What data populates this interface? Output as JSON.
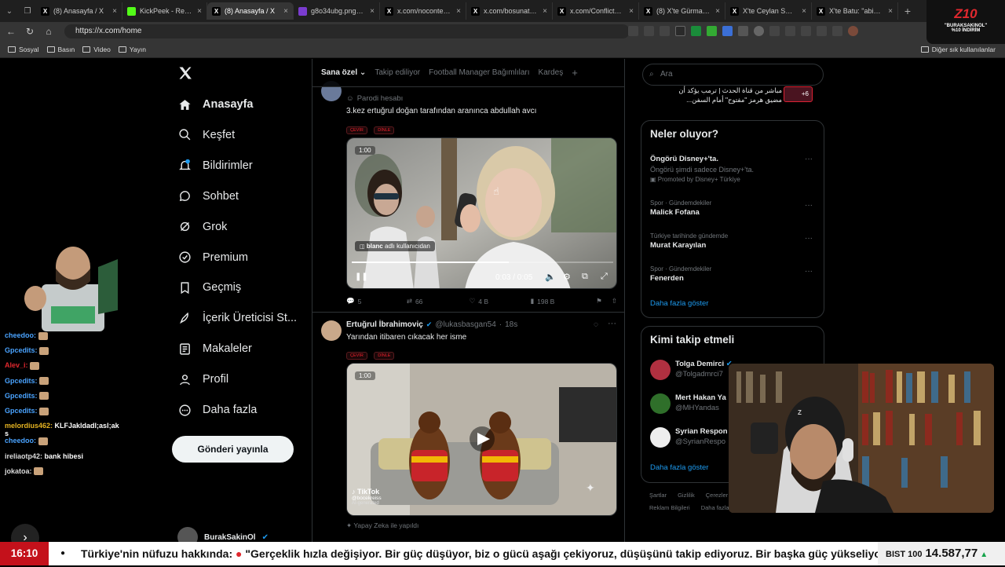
{
  "browser": {
    "tabs": [
      {
        "title": "(8) Anasayfa / X",
        "favicon": "x",
        "active": false
      },
      {
        "title": "KickPeek - Real-time",
        "favicon": "kick",
        "active": false
      },
      {
        "title": "(8) Anasayfa / X",
        "favicon": "x",
        "active": true
      },
      {
        "title": "g8o34ubg.png | Hız",
        "favicon": "img",
        "active": false
      },
      {
        "title": "x.com/noconteks12",
        "favicon": "x",
        "active": false
      },
      {
        "title": "x.com/bosunatiklam",
        "favicon": "x",
        "active": false
      },
      {
        "title": "x.com/ConflictTR/st",
        "favicon": "x",
        "active": false
      },
      {
        "title": "(8) X'te Gürman: \"H",
        "favicon": "x",
        "active": false
      },
      {
        "title": "X'te Ceylan Sever: \"I",
        "favicon": "x",
        "active": false
      },
      {
        "title": "X'te Batu: \"abisinin",
        "favicon": "x",
        "active": false
      }
    ],
    "url": "https://x.com/home",
    "bookmarks": [
      "Sosyal",
      "Basın",
      "Video",
      "Yayın"
    ],
    "other_bookmarks": "Diğer sık kullanılanlar"
  },
  "stream_logo": {
    "brand": "Z10",
    "line1": "\"BURAKSAKINOL\"",
    "line2": "%10 İNDİRİM"
  },
  "nav": {
    "items": [
      {
        "label": "Anasayfa",
        "icon": "home-icon",
        "active": true
      },
      {
        "label": "Keşfet",
        "icon": "search-icon",
        "active": false
      },
      {
        "label": "Bildirimler",
        "icon": "bell-icon",
        "active": false
      },
      {
        "label": "Sohbet",
        "icon": "chat-icon",
        "active": false
      },
      {
        "label": "Grok",
        "icon": "grok-icon",
        "active": false
      },
      {
        "label": "Premium",
        "icon": "premium-icon",
        "active": false
      },
      {
        "label": "Geçmiş",
        "icon": "bookmark-icon",
        "active": false
      },
      {
        "label": "İçerik Üreticisi St...",
        "icon": "rocket-icon",
        "active": false
      },
      {
        "label": "Makaleler",
        "icon": "article-icon",
        "active": false
      },
      {
        "label": "Profil",
        "icon": "person-icon",
        "active": false
      },
      {
        "label": "Daha fazla",
        "icon": "more-circle-icon",
        "active": false
      }
    ],
    "post_button": "Gönderi yayınla",
    "account_name": "BurakSakinOl"
  },
  "feed": {
    "tabs": [
      "Sana özel",
      "Takip ediliyor",
      "Football Manager Bağımlıları",
      "Kardeş"
    ],
    "tweets": [
      {
        "parody_label": "Parodi hesabı",
        "text": "3.kez ertuğrul doğan tarafından aranınca abdullah avcı",
        "badges": [
          "ÇEVİR",
          "DİNLE"
        ],
        "video_badge": "1:00",
        "video_credit_user": "blanc",
        "video_credit_text": "adlı kullanıcıdan",
        "video_time": "0:03 / 0:05",
        "video_progress": 0.6,
        "replies": "5",
        "reposts": "66",
        "likes": "4 B",
        "views": "198 B"
      },
      {
        "name": "Ertuğrul İbrahimoviç",
        "handle": "@lukasbasgan54",
        "time": "18s",
        "text": "Yarından itibaren cıkacak her isme",
        "badges": [
          "ÇEVİR",
          "DİNLE"
        ],
        "video_badge": "1:00",
        "tiktok_label": "TikTok",
        "tiktok_user": "@bocekreiss",
        "ai_label": "AI-generated",
        "ai_note": "Yapay Zeka ile yapıldı"
      }
    ]
  },
  "right": {
    "search_placeholder": "Ara",
    "top_snippet_line1": "مباشر من قناة الحدث | ترمب يؤكد أن",
    "top_snippet_line2": "مضيق هرمز \"مفتوح\" أمام السفن...",
    "top_snippet_badge": "+6",
    "trends_title": "Neler oluyor?",
    "trends": [
      {
        "category": "",
        "title": "Öngörü Disney+'ta.",
        "subtitle": "Öngörü şimdi sadece Disney+'ta.",
        "promoted": "Promoted by Disney+ Türkiye"
      },
      {
        "category": "Spor · Gündemdekiler",
        "title": "Malick Fofana"
      },
      {
        "category": "Türkiye tarihinde gündemde",
        "title": "Murat Karayılan"
      },
      {
        "category": "Spor · Gündemdekiler",
        "title": "Fenerden"
      }
    ],
    "trends_more": "Daha fazla göster",
    "who_title": "Kimi takip etmeli",
    "who": [
      {
        "name": "Tolga Demirci",
        "handle": "@Tolgadmrci7",
        "verified": true
      },
      {
        "name": "Mert Hakan Ya",
        "handle": "@MHYandas",
        "verified": false
      },
      {
        "name": "Syrian Respon",
        "handle": "@SyrianRespo",
        "verified": false
      }
    ],
    "who_more": "Daha fazla göster",
    "footer_line1": [
      "Şartlar",
      "Gizlilik",
      "Çerezler"
    ],
    "footer_line2": [
      "Reklam Bilgileri",
      "Daha fazla ..."
    ]
  },
  "chat": [
    {
      "user": "cheedoo:",
      "msg": "",
      "color": "#4aa3ff",
      "emote": true
    },
    {
      "user": "Gpcedits:",
      "msg": "",
      "color": "#4aa3ff",
      "emote": true
    },
    {
      "user": "Alev_i:",
      "msg": "",
      "color": "#e0282e",
      "emote": true
    },
    {
      "user": "Gpcedits:",
      "msg": "",
      "color": "#4aa3ff",
      "emote": true
    },
    {
      "user": "Gpcedits:",
      "msg": "",
      "color": "#4aa3ff",
      "emote": true
    },
    {
      "user": "Gpcedits:",
      "msg": "",
      "color": "#4aa3ff",
      "emote": true
    },
    {
      "user": "melordius462:",
      "msg": "KLFJakldadl;asl;ak",
      "msg2": "s",
      "color": "#e6b422",
      "emote": false
    },
    {
      "user": "cheedoo:",
      "msg": "",
      "color": "#4aa3ff",
      "emote": true
    },
    {
      "user": "ireliaotp42:",
      "msg": "bank hibesi",
      "color": "#dddddd",
      "emote": false
    },
    {
      "user": "jokatoa:",
      "msg": "",
      "color": "#dddddd",
      "emote": true
    }
  ],
  "ticker": {
    "clock": "16:10",
    "headline_prefix": "Türkiye'nin nüfuzu hakkında:",
    "headline_quote": "\"Gerçeklik hızla değişiyor. Bir güç düşüyor, biz o gücü aşağı çekiyoruz, düşüşünü takip ediyoruz. Bir başka güç yükseliyor.\"",
    "index_label": "BIST 100",
    "index_value": "14.587,77",
    "index_dir": "up"
  },
  "colors": {
    "accent": "#1d9bf0",
    "ticker_red": "#c4111b",
    "bg": "#000000"
  }
}
